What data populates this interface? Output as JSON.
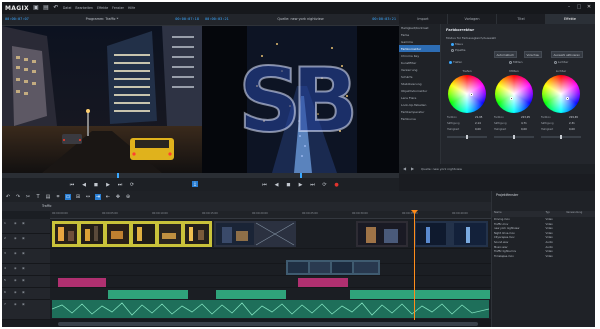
{
  "app": {
    "logo": "MAGIX"
  },
  "menu": [
    "Datei",
    "Bearbeiten",
    "Effekte",
    "Fenster",
    "Hilfe"
  ],
  "window_controls": [
    "–",
    "□",
    "✕"
  ],
  "source_preview": {
    "timecode_left": "00:00:07:07",
    "title": "Programm: Traffic *",
    "timecode_right": "00:00:07:18"
  },
  "program_preview": {
    "timecode_left": "00:00:03:21",
    "title": "Quelle: new york nightview",
    "timecode_right": "00:00:03:21"
  },
  "right_panel": {
    "tabs": [
      "Import",
      "Vorlagen",
      "Titel",
      "Effekte"
    ],
    "active_tab": 3,
    "effects": [
      "Helligkeit/Kontrast",
      "Farbe",
      "Gamma",
      "Farbkorrektur",
      "Chroma Key",
      "Kunstfilter",
      "Verzerrung",
      "Schärfe",
      "Stabilisierung",
      "Objektivkorrektur",
      "Lens Flare",
      "Look-Up-Tabellen",
      "Farbtemperatur",
      "Farbkurve"
    ],
    "selected_effect": 3,
    "section_title": "Farbkorrektur",
    "mode_label": "Modus für Farbausgleich/Auswahl",
    "mode_options": [
      "Maus",
      "Pipette"
    ],
    "buttons": [
      "Automatisch",
      "Vorschau",
      "Auswahl aktivieren"
    ],
    "range_options": [
      "Tiefen",
      "Mitten",
      "Lichter"
    ],
    "wheels": [
      {
        "label": "Tiefen",
        "hue": "21,95",
        "sat": "2,14",
        "lum": "0,00"
      },
      {
        "label": "Mitten",
        "hue": "223,95",
        "sat": "4,71",
        "lum": "0,00"
      },
      {
        "label": "Lichter",
        "hue": "229,65",
        "sat": "2,31",
        "lum": "0,00"
      }
    ],
    "param_labels": [
      "Farbton",
      "Sättigung",
      "Helligkeit"
    ]
  },
  "transport": {
    "buttons": [
      "⏮",
      "◀",
      "◼",
      "▶",
      "⏭",
      "⟳"
    ],
    "speed": "50 %",
    "zoom": "1:1"
  },
  "toolbar": {
    "icons": [
      "↶",
      "↷",
      "✂",
      "T",
      "▤",
      "⌗",
      "▭",
      "⊞",
      "↔",
      "⇥",
      "⇤",
      "✥",
      "⊕"
    ]
  },
  "timeline": {
    "project_label": "Traffic",
    "ruler_ticks": [
      "00:00:00:00",
      "00:00:05:00",
      "00:00:10:00",
      "00:00:15:00",
      "00:00:20:00",
      "00:00:25:00",
      "00:00:30:00",
      "00:00:35:00",
      "00:00:40:00"
    ],
    "tracks": [
      "1",
      "2",
      "3",
      "4",
      "5",
      "6",
      "7"
    ]
  },
  "project_panel": {
    "title": "Projektfenster",
    "columns": [
      "Name",
      "Typ",
      "Verwendung"
    ],
    "rows": [
      {
        "name": "Driving.mov",
        "type": "Video",
        "use": ""
      },
      {
        "name": "Traffic.mov",
        "type": "Video",
        "use": ""
      },
      {
        "name": "new york nightview",
        "type": "Video",
        "use": ""
      },
      {
        "name": "Night drive.mov",
        "type": "Video",
        "use": ""
      },
      {
        "name": "Cityscapes.mov",
        "type": "Video",
        "use": ""
      },
      {
        "name": "Sound.wav",
        "type": "Audio",
        "use": ""
      },
      {
        "name": "Music.wav",
        "type": "Audio",
        "use": ""
      },
      {
        "name": "Traffic lights.mov",
        "type": "Video",
        "use": ""
      },
      {
        "name": "Timelapse.mov",
        "type": "Video",
        "use": ""
      }
    ]
  },
  "colors": {
    "accent": "#2a7fd4",
    "timecode": "#3aa8ff",
    "playhead": "#ff8c1a",
    "clip_video": "#c9c23a",
    "clip_audio_green": "#2fa37a",
    "clip_audio_pink": "#b03070"
  },
  "watermark": "SB"
}
